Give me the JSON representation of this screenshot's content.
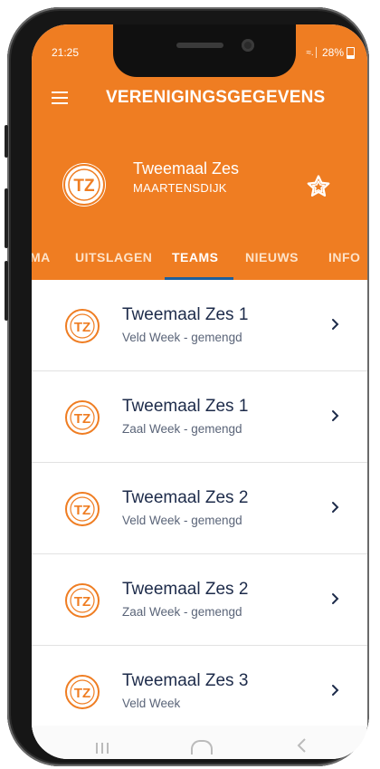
{
  "status_bar": {
    "time": "21:25",
    "signal": "↯.│",
    "battery": "28%"
  },
  "header": {
    "title": "VERENIGINGSGEGEVENS",
    "menu_icon": "hamburger-icon"
  },
  "club": {
    "name": "Tweemaal Zes",
    "city": "MAARTENSDIJK",
    "logo_initials": "TZ",
    "favorite_icon": "star-icon"
  },
  "tabs": [
    {
      "label": "MA",
      "active": false
    },
    {
      "label": "UITSLAGEN",
      "active": false
    },
    {
      "label": "TEAMS",
      "active": true
    },
    {
      "label": "NIEUWS",
      "active": false
    },
    {
      "label": "INFO",
      "active": false
    }
  ],
  "teams": [
    {
      "name": "Tweemaal Zes 1",
      "subtitle": "Veld Week - gemengd"
    },
    {
      "name": "Tweemaal Zes 1",
      "subtitle": "Zaal Week - gemengd"
    },
    {
      "name": "Tweemaal Zes 2",
      "subtitle": "Veld Week - gemengd"
    },
    {
      "name": "Tweemaal Zes 2",
      "subtitle": "Zaal Week - gemengd"
    },
    {
      "name": "Tweemaal Zes 3",
      "subtitle": "Veld Week"
    }
  ],
  "colors": {
    "accent": "#ef7d22",
    "tab_indicator": "#1f5f9a",
    "title_text": "#1d2b4a"
  }
}
